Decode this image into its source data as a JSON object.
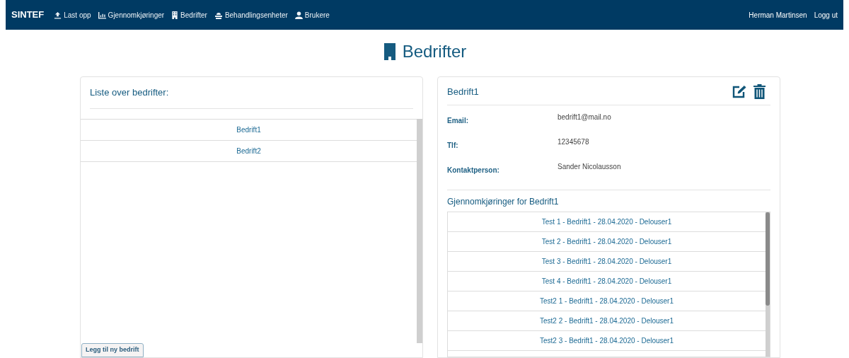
{
  "navbar": {
    "brand": "SINTEF",
    "links": [
      {
        "kind": "upload",
        "label": "Last opp"
      },
      {
        "kind": "chart",
        "label": "Gjennomkjøringer"
      },
      {
        "kind": "building",
        "label": "Bedrifter"
      },
      {
        "kind": "unit",
        "label": "Behandlingsenheter"
      },
      {
        "kind": "user",
        "label": "Brukere"
      }
    ],
    "user": "Herman Martinsen",
    "logout": "Logg ut"
  },
  "page_title": "Bedrifter",
  "company_list": {
    "title": "Liste over bedrifter:",
    "items": [
      "Bedrift1",
      "Bedrift2"
    ],
    "add_button": "Legg til ny bedrift"
  },
  "details": {
    "name": "Bedrift1",
    "fields": [
      {
        "label": "Email:",
        "value": "bedrift1@mail.no"
      },
      {
        "label": "Tlf:",
        "value": "12345678"
      },
      {
        "label": "Kontaktperson:",
        "value": "Sander Nicolausson"
      }
    ],
    "runs_title": "Gjennomkjøringer for Bedrift1",
    "runs": [
      "Test 1 - Bedrift1 - 28.04.2020 - Delouser1",
      "Test 2 - Bedrift1 - 28.04.2020 - Delouser1",
      "Test 3 - Bedrift1 - 28.04.2020 - Delouser1",
      "Test 4 - Bedrift1 - 28.04.2020 - Delouser1",
      "Test2 1 - Bedrift1 - 28.04.2020 - Delouser1",
      "Test2 2 - Bedrift1 - 28.04.2020 - Delouser1",
      "Test2 3 - Bedrift1 - 28.04.2020 - Delouser1"
    ]
  }
}
